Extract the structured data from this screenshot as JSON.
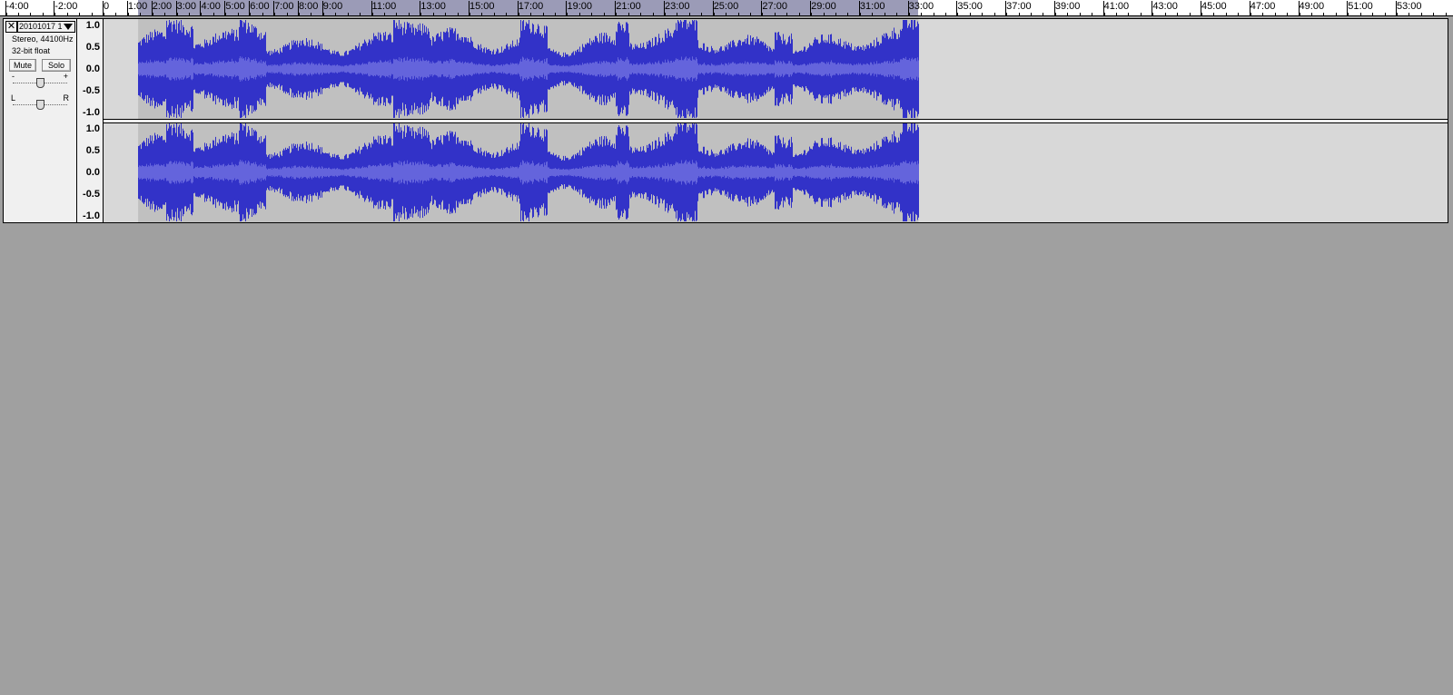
{
  "ruler": {
    "labels": [
      "-4:00",
      "-2:00",
      "0",
      "1:00",
      "2:00",
      "3:00",
      "4:00",
      "5:00",
      "6:00",
      "7:00",
      "8:00",
      "9:00",
      "11:00",
      "13:00",
      "15:00",
      "17:00",
      "19:00",
      "21:00",
      "23:00",
      "25:00",
      "27:00",
      "29:00",
      "31:00",
      "33:00",
      "35:00",
      "37:00",
      "39:00",
      "41:00",
      "43:00",
      "45:00",
      "47:00",
      "49:00",
      "51:00",
      "53:00"
    ],
    "label_seconds": [
      -240,
      -120,
      0,
      60,
      120,
      180,
      240,
      300,
      360,
      420,
      480,
      540,
      660,
      780,
      900,
      1020,
      1140,
      1260,
      1380,
      1500,
      1620,
      1740,
      1860,
      1980,
      2100,
      2220,
      2340,
      2460,
      2580,
      2700,
      2820,
      2940,
      3060,
      3180
    ],
    "play_region_end_seconds": 2004
  },
  "track": {
    "close_icon": "close-icon",
    "close_symbol": "✕",
    "name": "20101017 1",
    "format": "Stereo, 44100Hz",
    "bit_depth": "32-bit float",
    "mute_label": "Mute",
    "solo_label": "Solo",
    "gain_minus": "-",
    "gain_plus": "+",
    "pan_left": "L",
    "pan_right": "R",
    "gain_value_db": 0,
    "pan_value": 0,
    "clip_start_seconds": 85,
    "clip_end_seconds": 2004
  },
  "vertical_scale": {
    "labels": [
      "1.0",
      "0.5",
      "0.0",
      "-0.5",
      "-1.0"
    ]
  },
  "colors": {
    "waveform": "#3232c8",
    "waveform_rms": "#6464dc",
    "clip_background": "#c0c0c0",
    "empty_track": "#d8d8d8",
    "ruler_play_region": "#9b9bb7",
    "app_background": "#a0a0a0"
  }
}
